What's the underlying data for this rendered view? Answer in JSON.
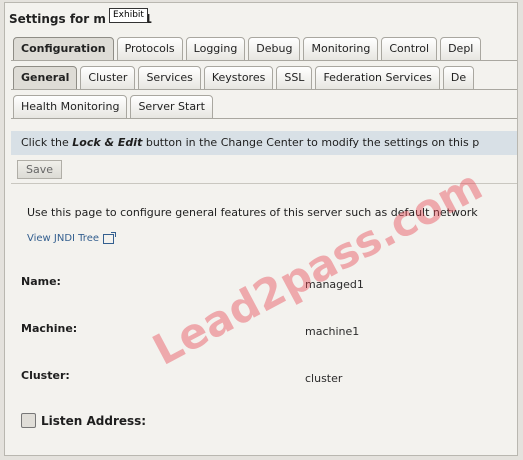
{
  "window": {
    "title": "Settings for m",
    "title_suffix": "1",
    "exhibit_badge": "Exhibit"
  },
  "tabs_level1": [
    "Configuration",
    "Protocols",
    "Logging",
    "Debug",
    "Monitoring",
    "Control",
    "Depl"
  ],
  "tabs_level2": [
    "General",
    "Cluster",
    "Services",
    "Keystores",
    "SSL",
    "Federation Services",
    "De"
  ],
  "tabs_level3": [
    "Health Monitoring",
    "Server Start"
  ],
  "notice": {
    "before": "Click the ",
    "em": "Lock & Edit",
    "after": " button in the Change Center to modify the settings on this p"
  },
  "save_label": "Save",
  "description": "Use this page to configure general features of this server such as default network",
  "jndi_link": "View JNDI Tree",
  "fields": {
    "name_label": "Name:",
    "name_value": "managed1",
    "machine_label": "Machine:",
    "machine_value": "machine1",
    "cluster_label": "Cluster:",
    "cluster_value": "cluster",
    "listen_label": "Listen Address:"
  },
  "watermark": "Lead2pass.com",
  "colors": {
    "notice_bg": "#d8e0e6",
    "link": "#335f8f",
    "watermark": "#e64650"
  }
}
